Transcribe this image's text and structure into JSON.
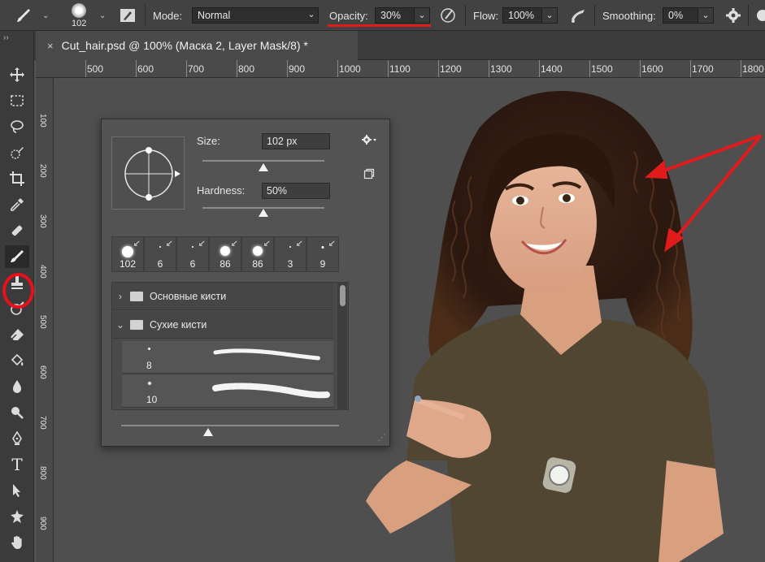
{
  "options_bar": {
    "brush_size": "102",
    "mode_label": "Mode:",
    "mode_value": "Normal",
    "opacity_label": "Opacity:",
    "opacity_value": "30%",
    "flow_label": "Flow:",
    "flow_value": "100%",
    "smoothing_label": "Smoothing:",
    "smoothing_value": "0%",
    "icons": [
      "brush-tool-icon",
      "brush-preset-icon",
      "brush-settings-panel-icon",
      "pressure-opacity-icon",
      "airbrush-icon",
      "smoothing-gear-icon",
      "symmetry-icon"
    ]
  },
  "document_tab": {
    "title": "Cut_hair.psd @ 100% (Маска 2, Layer Mask/8) *",
    "close": "×"
  },
  "ruler": {
    "horizontal": [
      "500",
      "600",
      "700",
      "800",
      "900",
      "1000",
      "1100",
      "1200",
      "1300",
      "1400",
      "1500",
      "1600",
      "1700",
      "1800"
    ],
    "vertical": [
      "100",
      "200",
      "300",
      "400",
      "500",
      "600",
      "700",
      "800",
      "900"
    ]
  },
  "toolbar": {
    "active_tool": "brush",
    "tools": [
      "move",
      "marquee",
      "lasso",
      "quick-selection",
      "crop",
      "eyedropper",
      "healing",
      "brush",
      "clone-stamp",
      "history-brush",
      "eraser",
      "paint-bucket",
      "blur",
      "dodge",
      "pen",
      "type",
      "path-selection",
      "shape",
      "hand"
    ]
  },
  "brush_panel": {
    "size_label": "Size:",
    "size_value": "102 px",
    "hardness_label": "Hardness:",
    "hardness_value": "50%",
    "size_fraction": 0.5,
    "hardness_fraction": 0.5,
    "presets": [
      "102",
      "6",
      "6",
      "86",
      "86",
      "3",
      "9"
    ],
    "groups": [
      {
        "name": "Основные кисти",
        "expanded": false
      },
      {
        "name": "Сухие кисти",
        "expanded": true
      }
    ],
    "brushes": [
      "8",
      "10"
    ]
  },
  "colors": {
    "accent_red": "#e01b1b",
    "panel_bg": "#535353",
    "ui_dark": "#3b3b3b"
  }
}
